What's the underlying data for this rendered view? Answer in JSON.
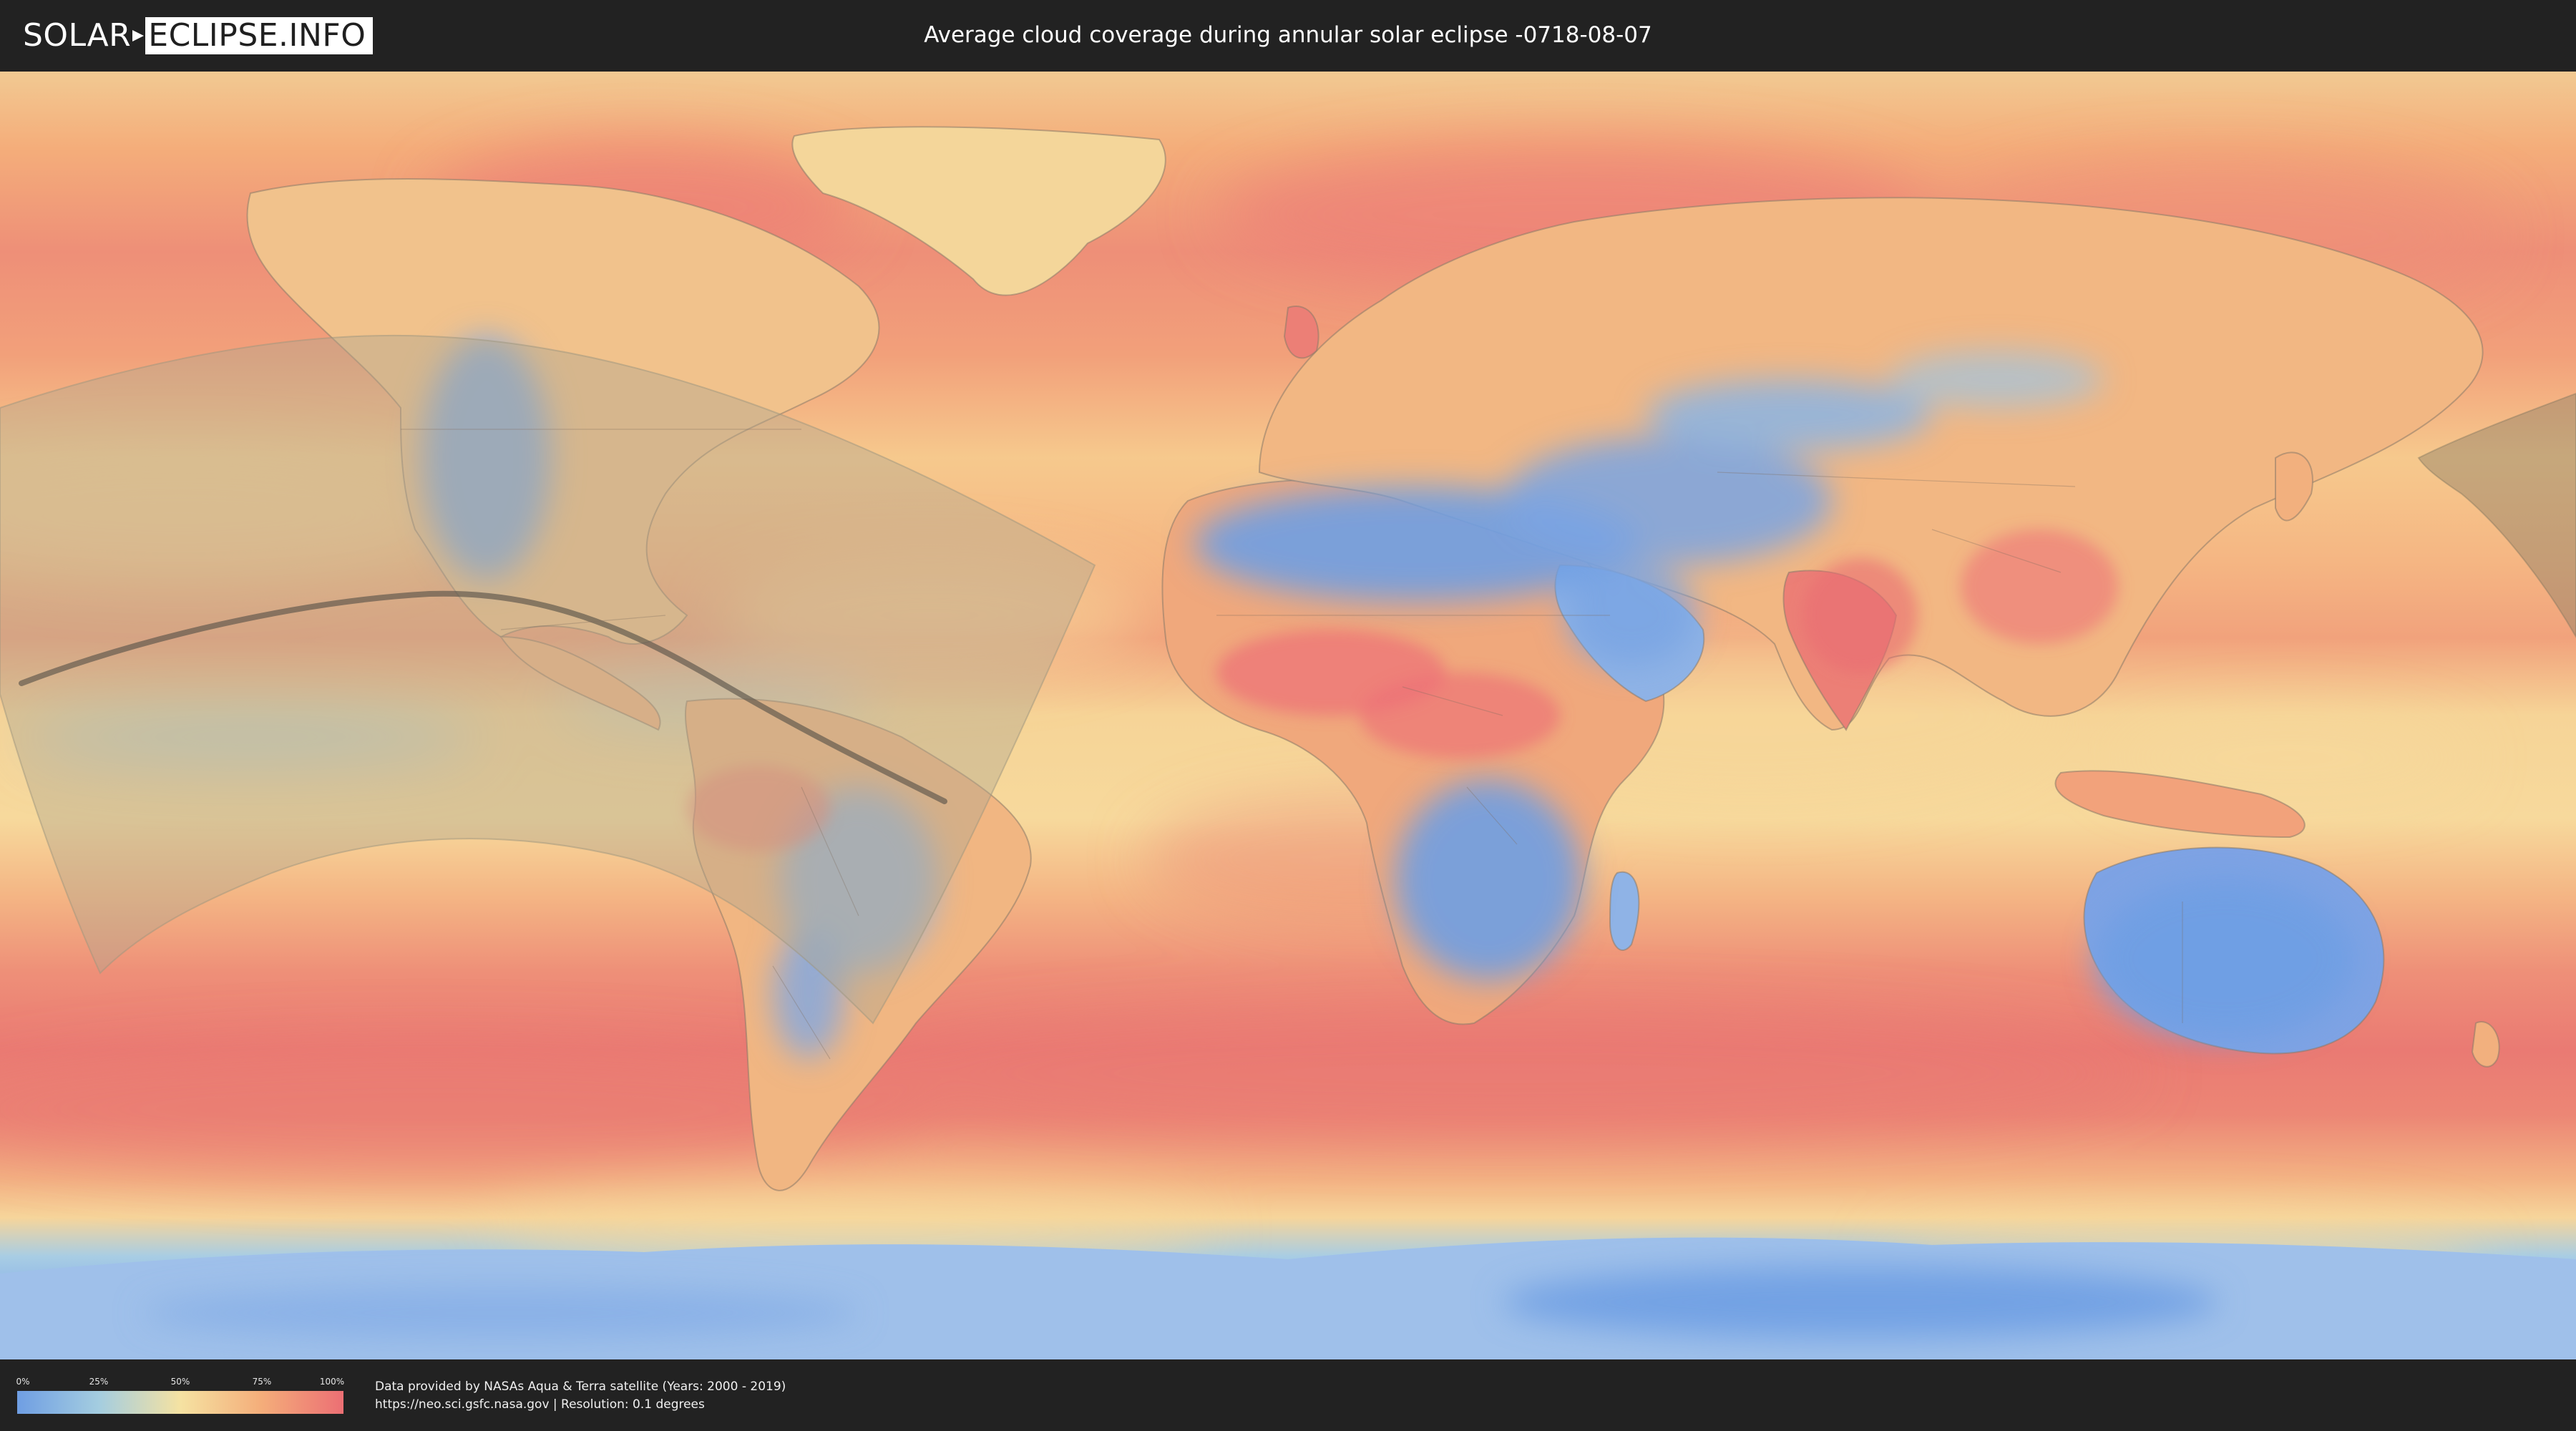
{
  "header": {
    "logo_left": "SOLAR",
    "logo_right": "ECLIPSE.INFO",
    "title": "Average cloud coverage during annular solar eclipse -0718-08-07"
  },
  "map": {
    "projection": "equirectangular",
    "layer": "average cloud coverage",
    "overlays": [
      "eclipse-visibility-region",
      "annularity-path"
    ],
    "colors": {
      "clear": "#6f9ee3",
      "low": "#a4cde0",
      "mid": "#f5e2a2",
      "high": "#f4ad7a",
      "overcast": "#ec6f74",
      "region_overlay": "#b0a890",
      "central_line": "#5a554a"
    }
  },
  "legend": {
    "ticks": [
      "0%",
      "25%",
      "50%",
      "75%",
      "100%"
    ],
    "ramp": [
      "#6f9ee3",
      "#a4cde0",
      "#f5e2a2",
      "#f4ad7a",
      "#ec6f74"
    ]
  },
  "footer": {
    "credit_line1": "Data provided by NASAs Aqua & Terra satellite (Years: 2000 - 2019)",
    "credit_line2": "https://neo.sci.gsfc.nasa.gov | Resolution: 0.1 degrees"
  }
}
